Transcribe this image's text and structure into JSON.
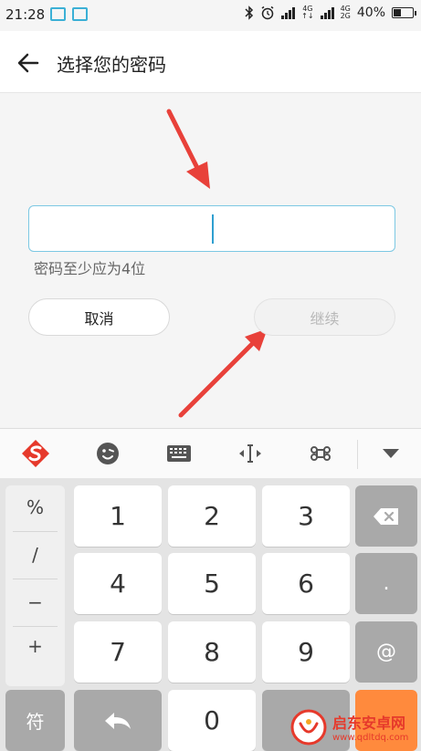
{
  "status_bar": {
    "time": "21:28",
    "network_top": "4G",
    "network_bottom": "4G",
    "network_bottom2": "2G",
    "battery": "40%"
  },
  "header": {
    "title": "选择您的密码"
  },
  "form": {
    "password_value": "",
    "hint": "密码至少应为4位",
    "cancel_label": "取消",
    "continue_label": "继续"
  },
  "keyboard": {
    "symbols": [
      "%",
      "/",
      "−",
      "+"
    ],
    "symbol_switch_label": "符",
    "keys": [
      "1",
      "2",
      "3",
      "4",
      "5",
      "6",
      "7",
      "8",
      "9",
      "0"
    ],
    "dot_label": ".",
    "at_label": "@"
  },
  "watermark": {
    "name": "启东安卓网",
    "url": "www.qdltdq.com"
  },
  "colors": {
    "accent": "#2f9fd0",
    "arrow_red": "#e8413a",
    "watermark_red": "#e6392b"
  }
}
